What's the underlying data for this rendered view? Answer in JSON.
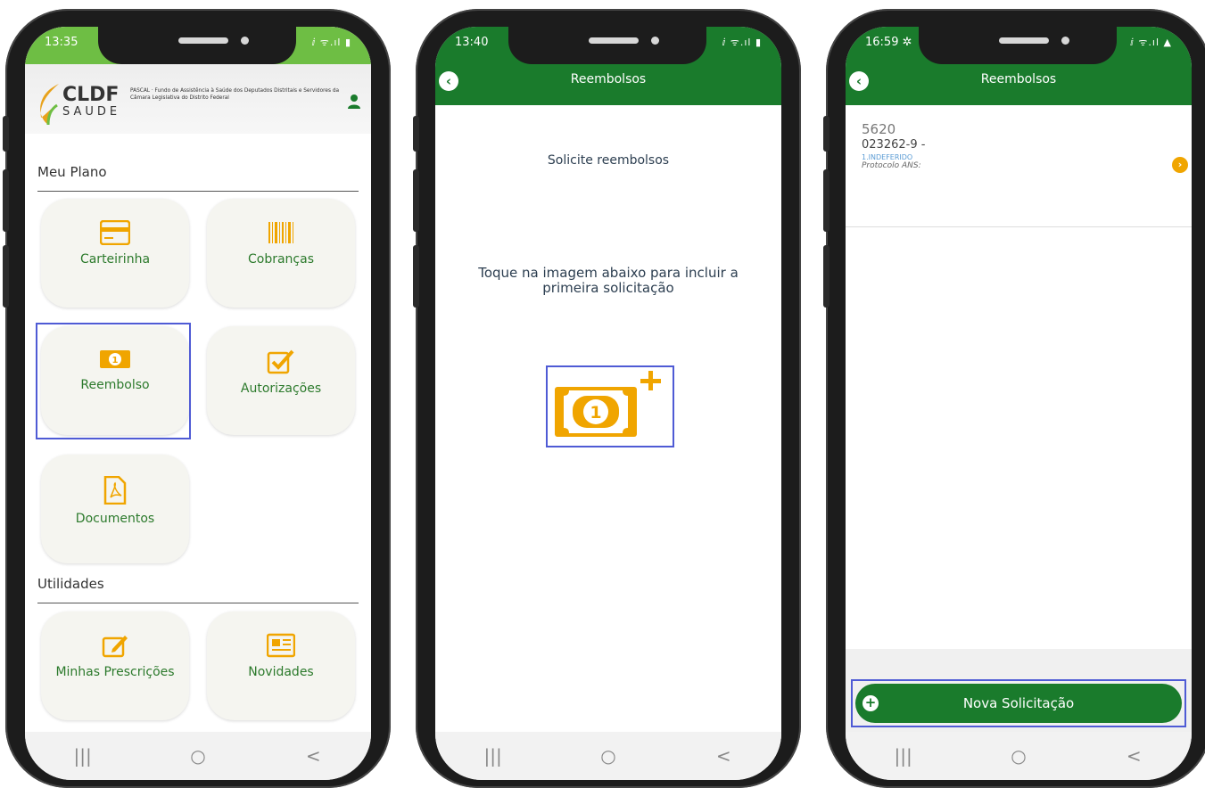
{
  "phone1": {
    "status_time": "13:35",
    "status_icons": "ⅈ ᯤ.ıl ▮",
    "logo": {
      "name": "CLDF",
      "sub": "SAUDE",
      "desc": "PASCAL · Fundo de Assistência à Saúde dos Deputados Distritais e Servidores da Câmara Legislativa do Distrito Federal"
    },
    "section1": "Meu Plano",
    "tiles": [
      {
        "label": "Carteirinha",
        "icon": "card-icon"
      },
      {
        "label": "Cobranças",
        "icon": "barcode-icon"
      },
      {
        "label": "Reembolso",
        "icon": "money-icon"
      },
      {
        "label": "Autorizações",
        "icon": "checkbox-icon"
      },
      {
        "label": "Documentos",
        "icon": "pdf-icon"
      }
    ],
    "section2": "Utilidades",
    "tiles2": [
      {
        "label": "Minhas Prescrições",
        "icon": "edit-icon"
      },
      {
        "label": "Novidades",
        "icon": "news-icon"
      }
    ]
  },
  "phone2": {
    "status_time": "13:40",
    "status_icons": "ⅈ ᯤ.ıl ▮",
    "title": "Reembolsos",
    "subtitle": "Solicite reembolsos",
    "hint": "Toque na imagem abaixo para incluir a primeira solicitação"
  },
  "phone3": {
    "status_time": "16:59 ✲",
    "status_icons": "ⅈ ᯤ.ıl ▲",
    "title": "Reembolsos",
    "item": {
      "id": "5620",
      "number": "023262-9 -",
      "status": "1.INDEFERIDO",
      "protocol": "Protocolo ANS:"
    },
    "button": "Nova Solicitação"
  },
  "nav": {
    "recent": "|||",
    "home": "○",
    "back": "<"
  },
  "colors": {
    "green": "#1a7b2c",
    "accent": "#f0a500",
    "highlight": "#4f5bd5"
  }
}
